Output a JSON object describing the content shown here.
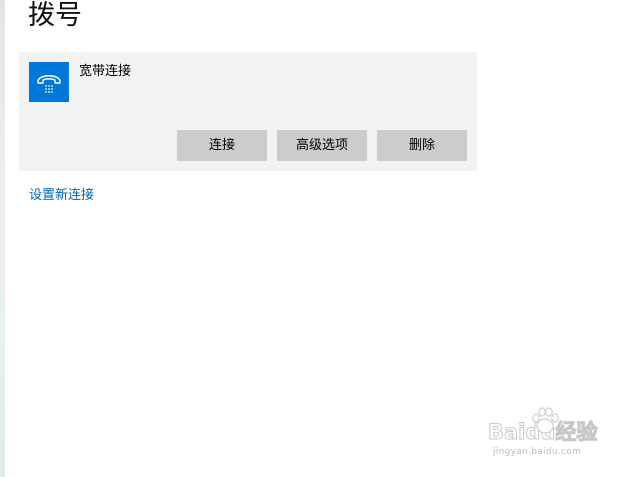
{
  "page": {
    "title": "拨号"
  },
  "connection": {
    "name": "宽带连接",
    "icon": "dialup-phone-icon",
    "icon_color": "#0078d7",
    "buttons": {
      "connect": "连接",
      "advanced": "高级选项",
      "delete": "删除"
    }
  },
  "links": {
    "new_connection": "设置新连接"
  },
  "watermark": {
    "logo_text": "Baidu经验",
    "domain": "jingyan.baidu.com"
  },
  "colors": {
    "accent": "#0078d7",
    "link": "#0067b8",
    "card_bg": "#f2f2f2",
    "button_bg": "#cccccc"
  }
}
